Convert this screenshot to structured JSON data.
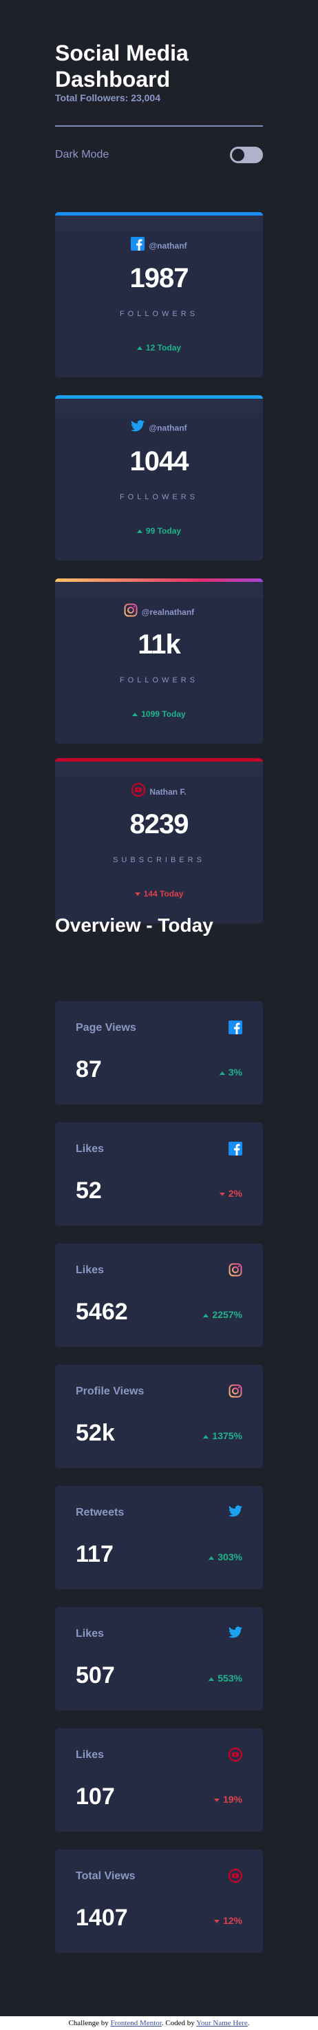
{
  "header": {
    "title": "Social Media Dashboard",
    "total_followers": "Total Followers: 23,004",
    "dark_mode_label": "Dark Mode"
  },
  "cards": [
    {
      "platform": "facebook",
      "icon": "facebook-icon",
      "handle": "@nathanf",
      "count": "1987",
      "unit": "FOLLOWERS",
      "today": "12 Today",
      "trend": "up",
      "color": "#198ff5"
    },
    {
      "platform": "twitter",
      "icon": "twitter-icon",
      "handle": "@nathanf",
      "count": "1044",
      "unit": "FOLLOWERS",
      "today": "99 Today",
      "trend": "up",
      "color": "#1ca0f2"
    },
    {
      "platform": "instagram",
      "icon": "instagram-icon",
      "handle": "@realnathanf",
      "count": "11k",
      "unit": "FOLLOWERS",
      "today": "1099 Today",
      "trend": "up",
      "color": "#fdc468"
    },
    {
      "platform": "youtube",
      "icon": "youtube-icon",
      "handle": "Nathan F.",
      "count": "8239",
      "unit": "SUBSCRIBERS",
      "today": "144 Today",
      "trend": "down",
      "color": "#c4032a"
    }
  ],
  "overview": {
    "title": "Overview - Today",
    "items": [
      {
        "label": "Page Views",
        "platform": "facebook",
        "value": "87",
        "pct": "3%",
        "trend": "up"
      },
      {
        "label": "Likes",
        "platform": "facebook",
        "value": "52",
        "pct": "2%",
        "trend": "down"
      },
      {
        "label": "Likes",
        "platform": "instagram",
        "value": "5462",
        "pct": "2257%",
        "trend": "up"
      },
      {
        "label": "Profile Views",
        "platform": "instagram",
        "value": "52k",
        "pct": "1375%",
        "trend": "up"
      },
      {
        "label": "Retweets",
        "platform": "twitter",
        "value": "117",
        "pct": "303%",
        "trend": "up"
      },
      {
        "label": "Likes",
        "platform": "twitter",
        "value": "507",
        "pct": "553%",
        "trend": "up"
      },
      {
        "label": "Likes",
        "platform": "youtube",
        "value": "107",
        "pct": "19%",
        "trend": "down"
      },
      {
        "label": "Total Views",
        "platform": "youtube",
        "value": "1407",
        "pct": "12%",
        "trend": "down"
      }
    ]
  },
  "attribution": {
    "prefix": "Challenge by",
    "link1": "Frontend Mentor",
    "middle": ". Coded by",
    "link2": "Your Name Here",
    "suffix": "."
  },
  "colors": {
    "background": "#1e202a",
    "card": "#252b43",
    "text_muted": "#8b97c6",
    "up": "#1db489",
    "down": "#dc414c",
    "instagram_gradient_end": "#e1306c"
  }
}
